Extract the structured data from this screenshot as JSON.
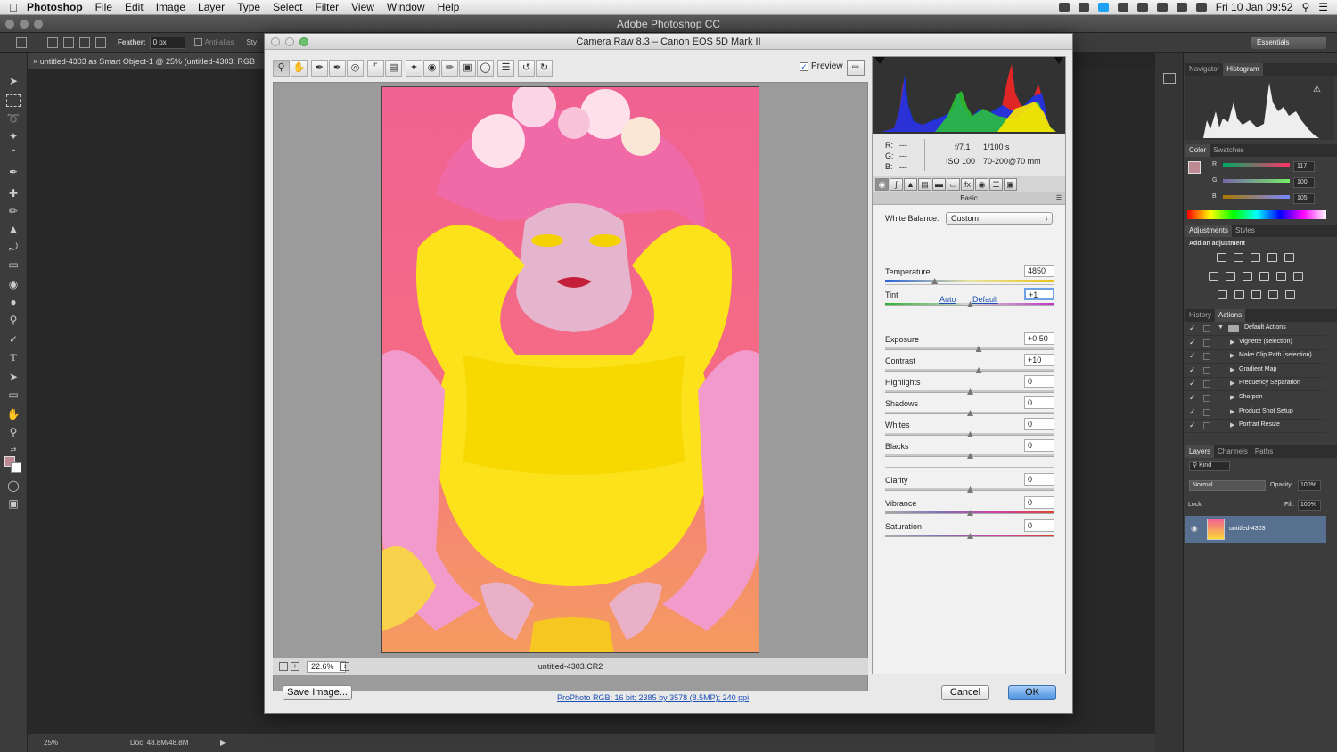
{
  "menubar": {
    "app": "Photoshop",
    "items": [
      "File",
      "Edit",
      "Image",
      "Layer",
      "Type",
      "Select",
      "Filter",
      "View",
      "Window",
      "Help"
    ],
    "clock": "Fri 10 Jan  09:52"
  },
  "ps_title": "Adobe Photoshop CC",
  "optbar": {
    "feather_label": "Feather:",
    "feather_value": "0 px",
    "antialias": "Anti-alias",
    "style_short": "Sty",
    "workspace": "Essentials"
  },
  "doc_tab": "untitled-4303 as Smart Object-1 @ 25% (untitled-4303, RGB",
  "statusbar": {
    "zoom": "25%",
    "doc": "Doc: 48.8M/48.8M"
  },
  "dialog": {
    "title": "Camera Raw 8.3  –  Canon EOS 5D Mark II",
    "preview_label": "Preview",
    "zoom_value": "22.6%",
    "filename": "untitled-4303.CR2",
    "save_button": "Save Image...",
    "workflow_link": "ProPhoto RGB; 16 bit; 2385 by 3578 (8.5MP); 240 ppi",
    "cancel_button": "Cancel",
    "ok_button": "OK"
  },
  "camera_info": {
    "r_label": "R:",
    "g_label": "G:",
    "b_label": "B:",
    "rgb_value": "---",
    "aperture": "f/7.1",
    "shutter": "1/100 s",
    "iso": "ISO 100",
    "lens": "70-200@70 mm"
  },
  "basic": {
    "header": "Basic",
    "wb_label": "White Balance:",
    "wb_value": "Custom",
    "auto_link": "Auto",
    "default_link": "Default",
    "sliders": [
      {
        "label": "Temperature",
        "value": "4850",
        "pos": 0.29
      },
      {
        "label": "Tint",
        "value": "+1",
        "pos": 0.5
      },
      {
        "label": "Exposure",
        "value": "+0.50",
        "pos": 0.55
      },
      {
        "label": "Contrast",
        "value": "+10",
        "pos": 0.55
      },
      {
        "label": "Highlights",
        "value": "0",
        "pos": 0.5
      },
      {
        "label": "Shadows",
        "value": "0",
        "pos": 0.5
      },
      {
        "label": "Whites",
        "value": "0",
        "pos": 0.5
      },
      {
        "label": "Blacks",
        "value": "0",
        "pos": 0.5
      },
      {
        "label": "Clarity",
        "value": "0",
        "pos": 0.5
      },
      {
        "label": "Vibrance",
        "value": "0",
        "pos": 0.5
      },
      {
        "label": "Saturation",
        "value": "0",
        "pos": 0.5
      }
    ]
  },
  "right_panels": {
    "nav_tab": "Navigator",
    "hist_tab": "Histogram",
    "color_tab": "Color",
    "swatches_tab": "Swatches",
    "color_r": "117",
    "color_g": "100",
    "color_b": "105",
    "r_label": "R",
    "g_label": "G",
    "b_label": "B",
    "adj_tab": "Adjustments",
    "styles_tab": "Styles",
    "add_adjustment": "Add an adjustment",
    "history_tab": "History",
    "actions_tab": "Actions",
    "actions": [
      "Default Actions",
      "Vignette (selection)",
      "Make Clip Path (selection)",
      "Gradient Map",
      "Frequency Separation",
      "Sharpen",
      "Product Shot Setup",
      "Portrait Resize"
    ],
    "layers_tab": "Layers",
    "channels_tab": "Channels",
    "paths_tab": "Paths",
    "kind_label": "Kind",
    "blend_mode": "Normal",
    "opacity_label": "Opacity:",
    "opacity_value": "100%",
    "lock_label": "Lock:",
    "fill_label": "Fill:",
    "fill_value": "100%",
    "layer_name": "untitled-4303"
  }
}
